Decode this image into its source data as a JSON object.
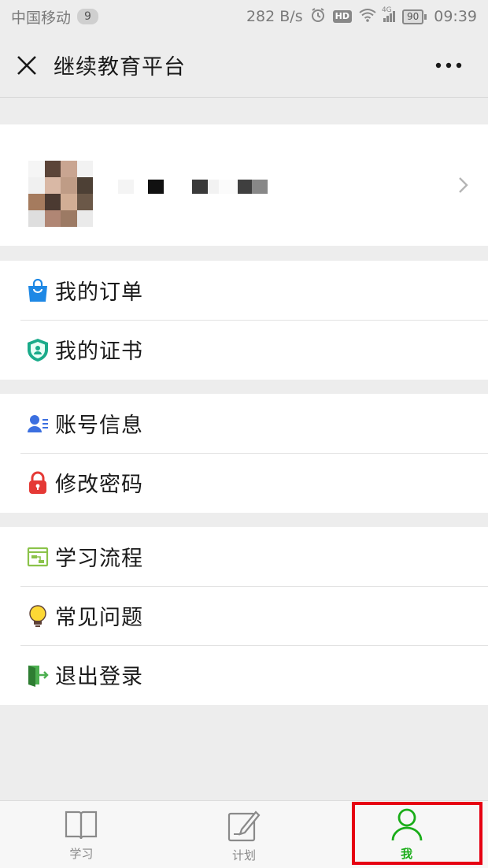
{
  "status_bar": {
    "carrier": "中国移动",
    "notification_count": "9",
    "network_speed": "282 B/s",
    "hd_label": "HD",
    "signal_label": "4G",
    "battery": "90",
    "time": "09:39"
  },
  "header": {
    "title": "继续教育平台"
  },
  "profile": {
    "avatar_redacted": true,
    "name_redacted": true
  },
  "menu_groups": [
    {
      "items": [
        {
          "label": "我的订单",
          "icon": "shopping-bag-icon"
        },
        {
          "label": "我的证书",
          "icon": "certificate-shield-icon"
        }
      ]
    },
    {
      "items": [
        {
          "label": "账号信息",
          "icon": "account-info-icon"
        },
        {
          "label": "修改密码",
          "icon": "lock-icon"
        }
      ]
    },
    {
      "items": [
        {
          "label": "学习流程",
          "icon": "flowchart-icon"
        },
        {
          "label": "常见问题",
          "icon": "lightbulb-icon"
        },
        {
          "label": "退出登录",
          "icon": "exit-door-icon"
        }
      ]
    }
  ],
  "tabs": [
    {
      "label": "学习",
      "icon": "book-icon",
      "active": false
    },
    {
      "label": "计划",
      "icon": "plan-edit-icon",
      "active": false
    },
    {
      "label": "我",
      "icon": "person-icon",
      "active": true
    }
  ],
  "colors": {
    "accent_green": "#1aad19",
    "highlight_red": "#e60012",
    "background": "#ededed"
  }
}
